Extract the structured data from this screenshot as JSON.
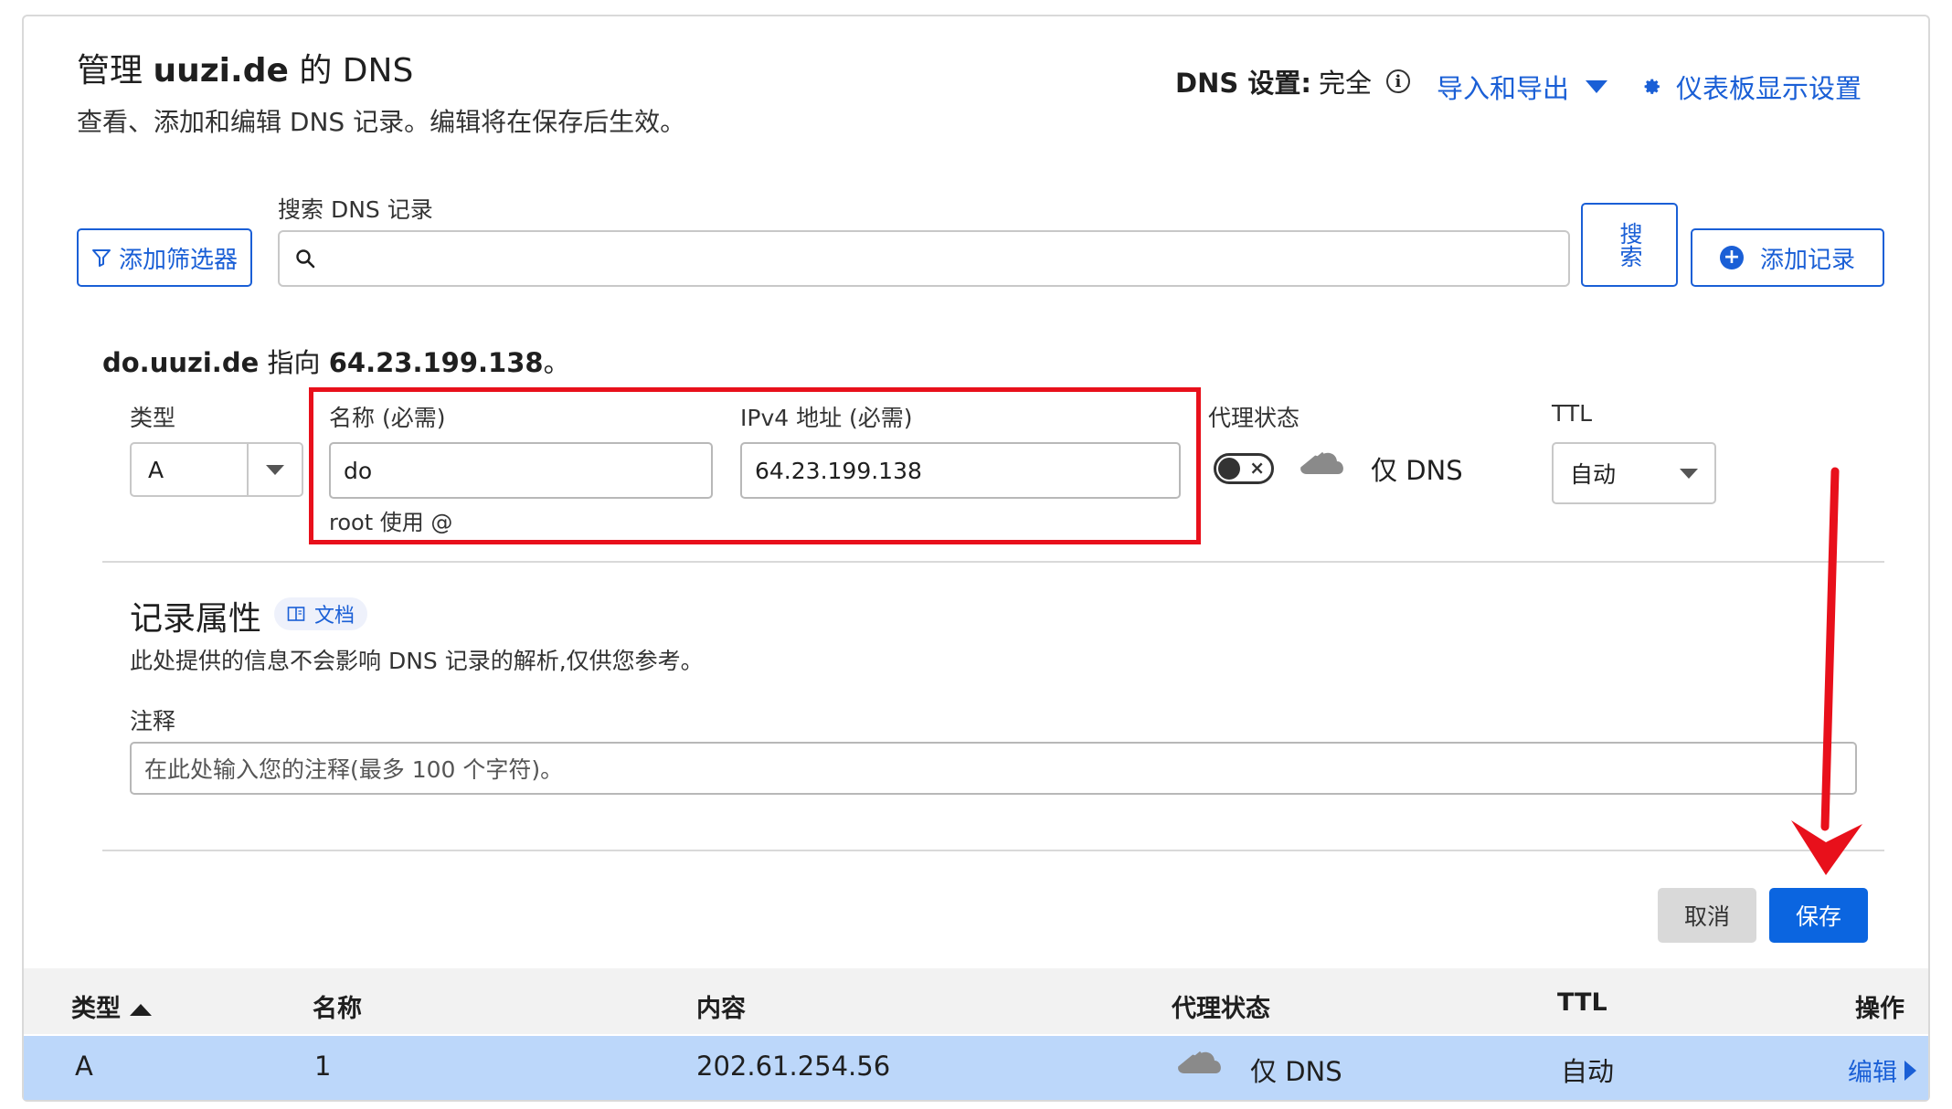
{
  "header": {
    "title_prefix": "管理",
    "title_domain": "uuzi.de",
    "title_suffix": "的 DNS",
    "subtitle": "查看、添加和编辑 DNS 记录。编辑将在保存后生效。",
    "dns_setting_label": "DNS 设置:",
    "dns_setting_value": "完全",
    "import_export": "导入和导出",
    "dashboard_settings": "仪表板显示设置"
  },
  "search": {
    "label": "搜索 DNS 记录",
    "placeholder": "",
    "button_label": "搜索",
    "filter_button": "添加筛选器",
    "add_record_button": "添加记录"
  },
  "editor": {
    "points_to_host": "do.uuzi.de",
    "points_to_mid": "指向",
    "points_to_ip": "64.23.199.138",
    "points_to_end": "。",
    "type_label": "类型",
    "type_value": "A",
    "name_label": "名称 (必需)",
    "name_value": "do",
    "name_hint": "root 使用 @",
    "ipv4_label": "IPv4 地址 (必需)",
    "ipv4_value": "64.23.199.138",
    "proxy_label": "代理状态",
    "proxy_value": "仅 DNS",
    "ttl_label": "TTL",
    "ttl_value": "自动"
  },
  "record_properties": {
    "title": "记录属性",
    "doc_badge": "文档",
    "description": "此处提供的信息不会影响 DNS 记录的解析,仅供您参考。",
    "comment_label": "注释",
    "comment_placeholder": "在此处输入您的注释(最多 100 个字符)。"
  },
  "actions": {
    "cancel": "取消",
    "save": "保存"
  },
  "table": {
    "columns": [
      "类型",
      "名称",
      "内容",
      "代理状态",
      "TTL",
      "操作"
    ],
    "rows": [
      {
        "type": "A",
        "name": "1",
        "content": "202.61.254.56",
        "proxy": "仅 DNS",
        "ttl": "自动",
        "action": "编辑"
      }
    ]
  },
  "colors": {
    "accent_blue": "#1a5fd6",
    "save_blue": "#0b65e0",
    "highlight_red": "#e8101b",
    "row_selected": "#bcd7fa"
  }
}
